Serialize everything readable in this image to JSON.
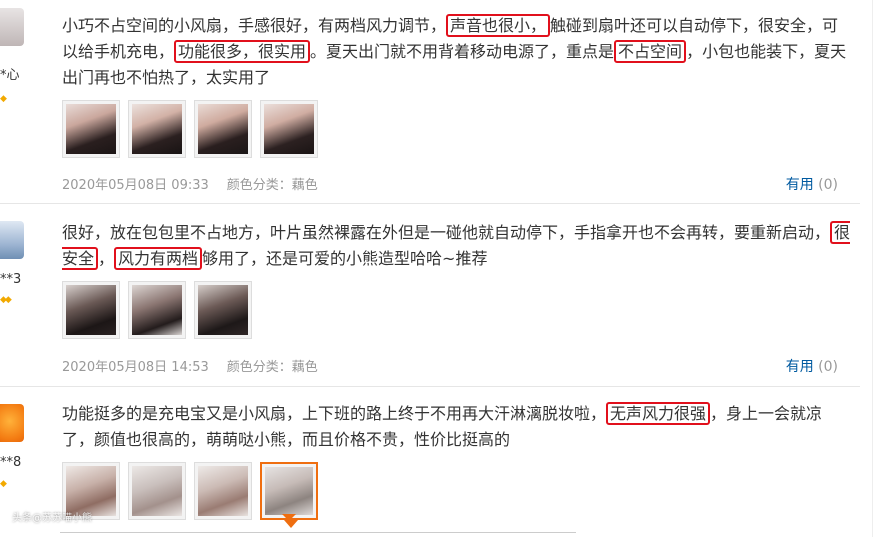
{
  "reviews": [
    {
      "user_name": "*心",
      "text_parts": [
        "小巧不占空间的小风扇，手感很好，有两档风力调节，",
        "声音也很小，",
        "触碰到扇叶还可以自动停下，很安全，可以给手机充电，",
        "功能很多，很实用",
        "。夏天出门就不用背着移动电源了，重点是",
        "不占空间",
        "，小包也能装下，夏天出门再也不怕热了，太实用了"
      ],
      "date": "2020年05月08日 09:33",
      "sku": "颜色分类：藕色",
      "useful_label": "有用",
      "useful_count": "(0)"
    },
    {
      "user_name": "**3",
      "text_parts": [
        "很好，放在包包里不占地方，叶片虽然裸露在外但是一碰他就自动停下，手指拿开也不会再转，要重新启动，",
        "很安全",
        "，",
        "风力有两档",
        "够用了，还是可爱的小熊造型哈哈~推荐"
      ],
      "date": "2020年05月08日 14:53",
      "sku": "颜色分类：藕色",
      "useful_label": "有用",
      "useful_count": "(0)"
    },
    {
      "user_name": "**8",
      "text_parts": [
        "功能挺多的是充电宝又是小风扇，上下班的路上终于不用再大汗淋漓脱妆啦，",
        "无声风力很强",
        "，身上一会就凉了，颜值也很高的，萌萌哒小熊，而且价格不贵，性价比挺高的"
      ]
    }
  ],
  "watermark": "头条@苏苏喵小熊",
  "colors": {
    "highlight": "#e1101c",
    "accent_orange": "#ef6e10",
    "link_blue": "#005aa0"
  }
}
